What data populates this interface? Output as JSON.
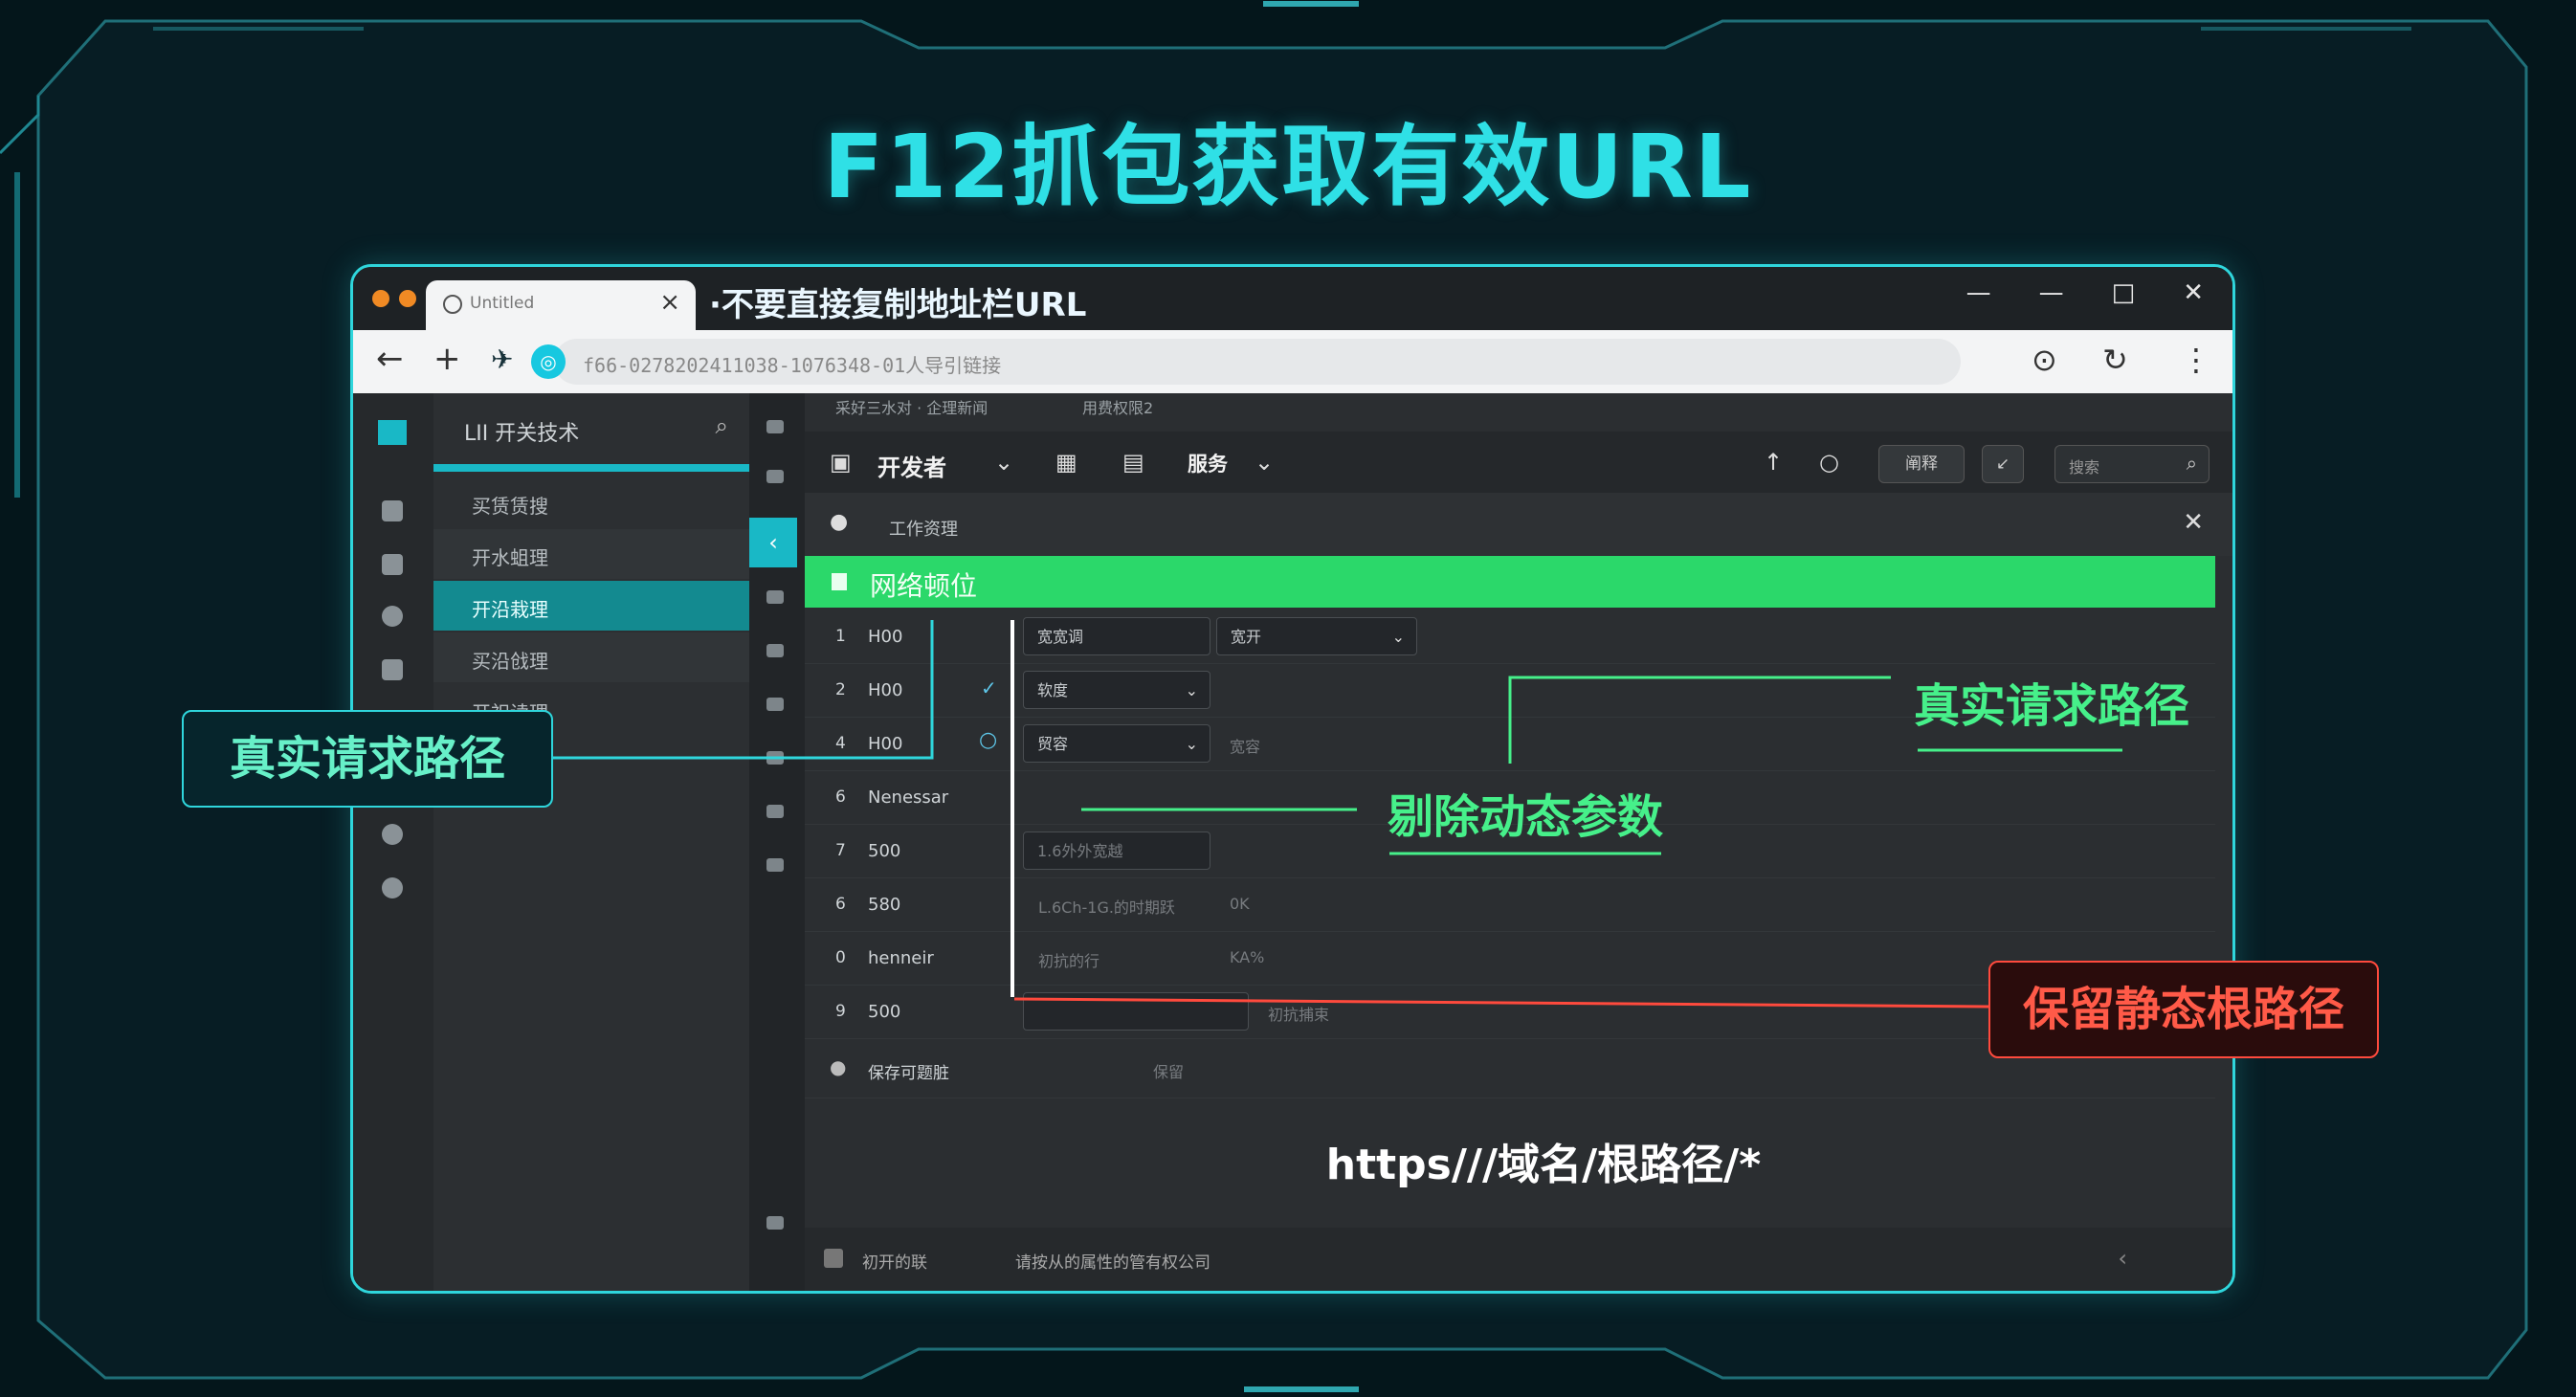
{
  "title": "F12抓包获取有效URL",
  "browser": {
    "tab_title": "Untitled",
    "tab_note": "·不要直接复制地址栏URL",
    "url": "f66-0278202411038-1076348-01人导引链接",
    "win_controls": [
      "—",
      "—",
      "□",
      "✕"
    ]
  },
  "sidebar": {
    "title": "LII 开关技术",
    "items": [
      {
        "label": "买赁赁搜"
      },
      {
        "label": "开水蛆理"
      },
      {
        "label": "开沿栽理"
      },
      {
        "label": "买沿戗理"
      },
      {
        "label": "开祀读理"
      }
    ]
  },
  "devtools": {
    "crumb1": "采好三水对 · 企理新闻",
    "crumb2": "用费权限2",
    "toolbar_label": "开发者",
    "toolbar_label2": "服务",
    "toolbar_btn1": "阐释",
    "toolbar_search": "搜索",
    "sub_label": "工作资理",
    "green_bar_label": "网络顿位",
    "rows": [
      {
        "n": "1",
        "s": "H00",
        "sel1": "宽宽调",
        "sel2": "宽开"
      },
      {
        "n": "2",
        "s": "H00",
        "sel1": "软度",
        "sel2": ""
      },
      {
        "n": "4",
        "s": "H00",
        "sel1": "贸容",
        "sel2": "宽容"
      },
      {
        "n": "6",
        "s": "Nenessar",
        "sel1": "",
        "sel2": ""
      },
      {
        "n": "7",
        "s": "500",
        "sel1": "1.6外外宽越",
        "sel2": ""
      },
      {
        "n": "6",
        "s": "580",
        "sel1": "L.6Ch-1G.的时期跃",
        "sel2": "0K"
      },
      {
        "n": "0",
        "s": "henneir",
        "sel1": "初抗的行",
        "sel2": "KA%"
      },
      {
        "n": "9",
        "s": "500",
        "sel1": "",
        "sel2": "初抗捕束"
      }
    ],
    "row_last": "保存可题脏",
    "row_last2": "保留",
    "url_pattern": "https///域名/根路径/*",
    "footer_l1": "初开的联",
    "footer_l2": "请按从的属性的管有权公司"
  },
  "callouts": {
    "left": "真实请求路径",
    "right": "真实请求路径",
    "middle": "剔除动态参数",
    "red": "保留静态根路径"
  },
  "colors": {
    "accent": "#2fd6dc",
    "green": "#2bd86a",
    "red": "#ff4a3d",
    "background": "#04161b"
  }
}
